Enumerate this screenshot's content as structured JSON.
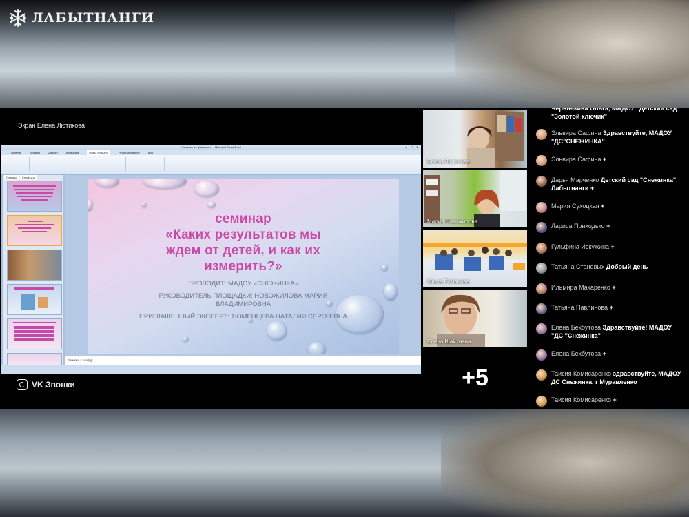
{
  "logo": {
    "text": "ЛАБЫТНАНГИ"
  },
  "call": {
    "screen_label": "Экран Елена Лютикова",
    "brand": "VK Звонки",
    "extra_participants": "+5"
  },
  "ppt": {
    "window_title": "Семинар по финансам — Microsoft PowerPoint",
    "tabs": [
      "Главная",
      "Вставка",
      "Дизайн",
      "Анимация",
      "Показ слайдов",
      "Рецензирование",
      "Вид"
    ],
    "panel_tabs": [
      "Слайды",
      "Структура"
    ],
    "notes_placeholder": "Заметки к слайду"
  },
  "slide": {
    "title_lines": [
      "семинар",
      "«Каких результатов мы",
      "ждем от детей, и как их",
      "измерить?»"
    ],
    "conducted_by": "ПРОВОДИТ: МАДОУ «СНЕЖИНКА»",
    "leader_line1": "РУКОВОДИТЕЛЬ ПЛОЩАДКИ: НОВОЖИЛОВА МАРИЯ",
    "leader_line2": "ВЛАДИМИРОВНА",
    "expert": "ПРИГЛАШЕННЫЙ ЭКСПЕРТ: ТЮМЕНЦЕВА НАТАЛИЯ СЕРГЕЕВНА"
  },
  "participants": [
    {
      "name": "Елена Лютикова"
    },
    {
      "name": "Мария Новожилова"
    },
    {
      "name": "Ольга Романова"
    },
    {
      "name": "Елена Шайхиева"
    }
  ],
  "chat": [
    {
      "author": "",
      "text": "Черничкина Ольга, МАДОУ \"Детский сад \"Золотой ключик\"",
      "avatar": "#c9a37a"
    },
    {
      "author": "Эльвира Сафина",
      "text": "Здравствуйте, МАДОУ \"ДС\"СНЕЖИНКА\"",
      "avatar": "#d8a07a"
    },
    {
      "author": "Эльвира Сафина",
      "text": "+",
      "avatar": "#d8a07a"
    },
    {
      "author": "Дарья Марченко",
      "text": "Детский сад \"Снежинка\" Лабытнанги +",
      "avatar": "#9a6a5a"
    },
    {
      "author": "Мария Сухоцкая",
      "text": "+",
      "avatar": "#c98a8a"
    },
    {
      "author": "Лариса Приходько",
      "text": "+",
      "avatar": "#6a5a8a"
    },
    {
      "author": "Гульфина Искужина",
      "text": "+",
      "avatar": "#b57a5a"
    },
    {
      "author": "Татьяна Становых",
      "text": "Добрый день",
      "avatar": "#8a9aa8"
    },
    {
      "author": "Ильмира Макаренко",
      "text": "+",
      "avatar": "#b08070"
    },
    {
      "author": "Татьяна Павлинова",
      "text": "+",
      "avatar": "#6e6a8a"
    },
    {
      "author": "Елена Бехбутова",
      "text": "Здравствуйте! МАДОУ \"ДС \"Снежинка\"",
      "avatar": "#a07aa8"
    },
    {
      "author": "Елена Бехбутова",
      "text": "+",
      "avatar": "#a07aa8"
    },
    {
      "author": "Таисия Комисаренко",
      "text": "здравствуйте, МАДОУ ДС Снежинка, г Муравленко",
      "avatar": "#d6a050"
    },
    {
      "author": "Таисия Комисаренко",
      "text": "+",
      "avatar": "#d6a050"
    }
  ]
}
